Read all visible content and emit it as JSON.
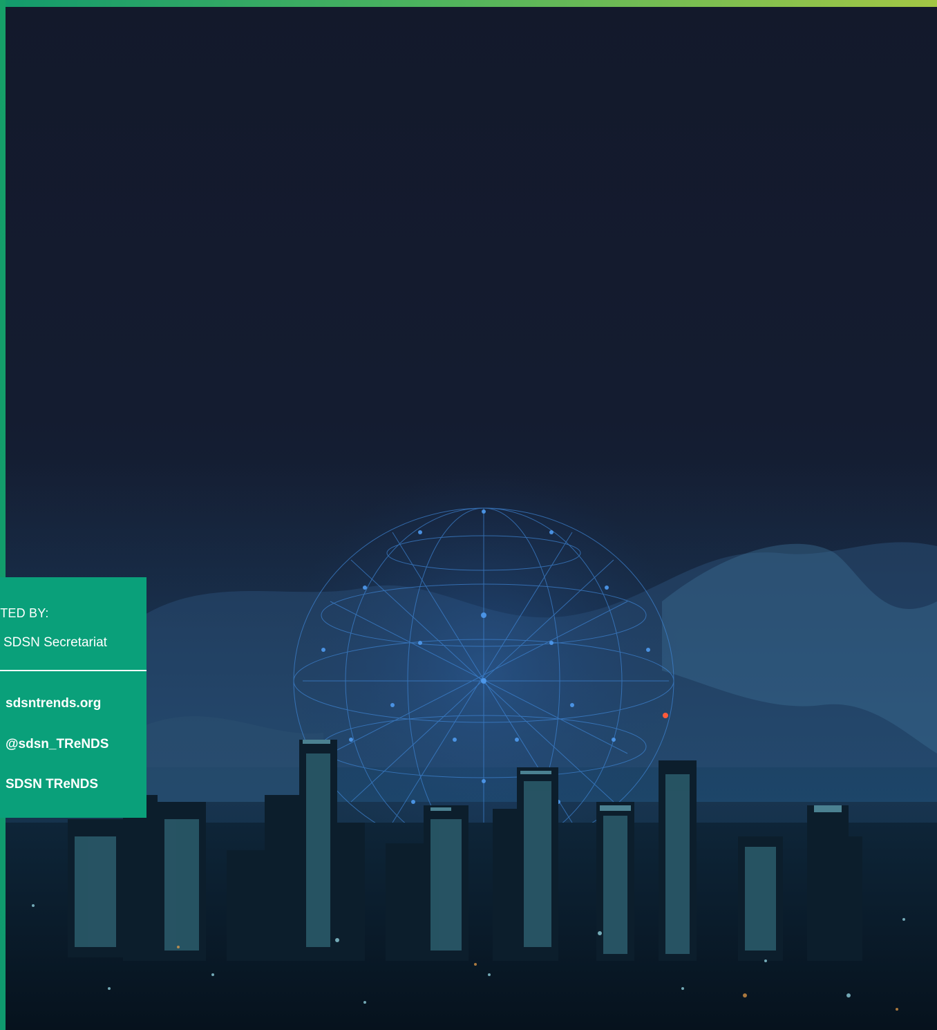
{
  "colors": {
    "accent_green": "#0aa07a",
    "top_bar_gradient": [
      "#129a6c",
      "#a3c745"
    ],
    "night_sky": "#13192b"
  },
  "info_box": {
    "hosted_label": "STED BY:",
    "hosted_value": "SDSN Secretariat",
    "links": [
      {
        "label": "sdsntrends.org"
      },
      {
        "label": "@sdsn_TReNDS"
      },
      {
        "label": "SDSN TReNDS"
      }
    ]
  },
  "background": {
    "icon": "city-skyline-with-network-globe"
  }
}
